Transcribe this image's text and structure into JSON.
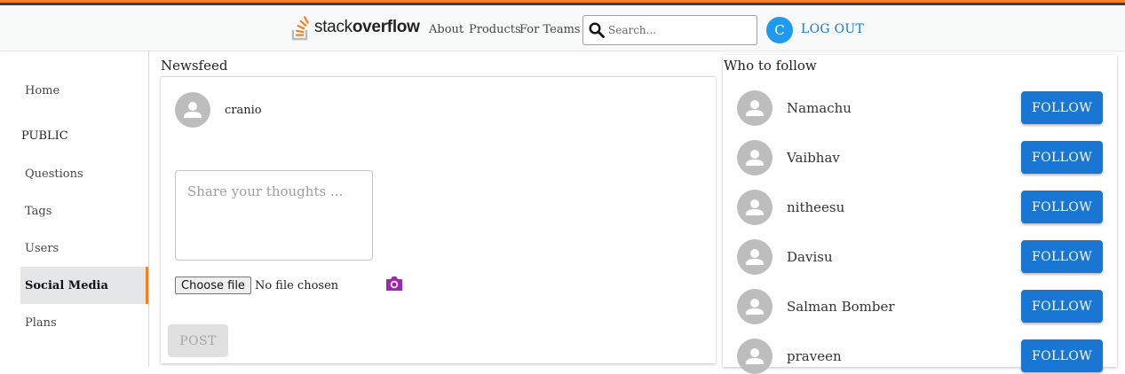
{
  "header": {
    "logo_text_light": "stack",
    "logo_text_bold": "overflow",
    "nav": [
      "About",
      "Products",
      "For Teams"
    ],
    "search_placeholder": "Search...",
    "user_initial": "C",
    "logout_label": "LOG OUT"
  },
  "sidebar": {
    "home": "Home",
    "section_heading": "PUBLIC",
    "items": [
      "Questions",
      "Tags",
      "Users",
      "Social Media",
      "Plans"
    ],
    "active_item": "Social Media"
  },
  "newsfeed": {
    "title": "Newsfeed",
    "username": "cranio",
    "thoughts_placeholder": "Share your thoughts ...",
    "choose_file_label": "Choose file",
    "no_file_text": "No file chosen",
    "post_label": "POST"
  },
  "who_to_follow": {
    "title": "Who to follow",
    "follow_label": "FOLLOW",
    "users": [
      "Namachu",
      "Vaibhav",
      "nitheesu",
      "Davisu",
      "Salman Bomber",
      "praveen"
    ]
  },
  "colors": {
    "accent_orange": "#f48024",
    "primary_blue": "#1976d2",
    "avatar_blue": "#1e9bf0",
    "camera_purple": "#9c27b0"
  }
}
